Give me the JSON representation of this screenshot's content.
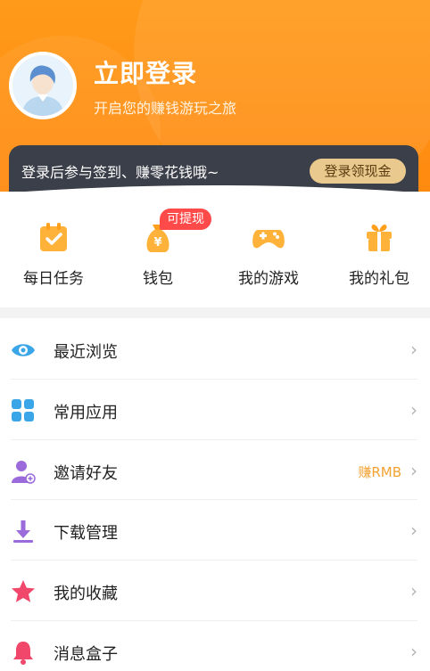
{
  "profile": {
    "title": "立即登录",
    "subtitle": "开启您的赚钱游玩之旅"
  },
  "banner": {
    "text": "登录后参与签到、赚零花钱哦~",
    "button": "登录领现金"
  },
  "quick_menu": {
    "badge": "可提现",
    "items": [
      {
        "label": "每日任务",
        "icon": "calendar-check-icon"
      },
      {
        "label": "钱包",
        "icon": "money-bag-icon"
      },
      {
        "label": "我的游戏",
        "icon": "gamepad-icon"
      },
      {
        "label": "我的礼包",
        "icon": "gift-icon"
      }
    ]
  },
  "menu": {
    "items": [
      {
        "label": "最近浏览",
        "icon": "eye-icon",
        "extra": ""
      },
      {
        "label": "常用应用",
        "icon": "apps-grid-icon",
        "extra": ""
      },
      {
        "label": "邀请好友",
        "icon": "invite-friend-icon",
        "extra": "赚RMB"
      },
      {
        "label": "下载管理",
        "icon": "download-icon",
        "extra": ""
      },
      {
        "label": "我的收藏",
        "icon": "star-icon",
        "extra": ""
      },
      {
        "label": "消息盒子",
        "icon": "bell-icon",
        "extra": ""
      }
    ]
  },
  "colors": {
    "header_orange": "#ff8f14",
    "banner_dark": "#3b3f49",
    "gold_button": "#e9c98d",
    "badge_red": "#ff4a4a",
    "accent_text": "#f2a233"
  }
}
